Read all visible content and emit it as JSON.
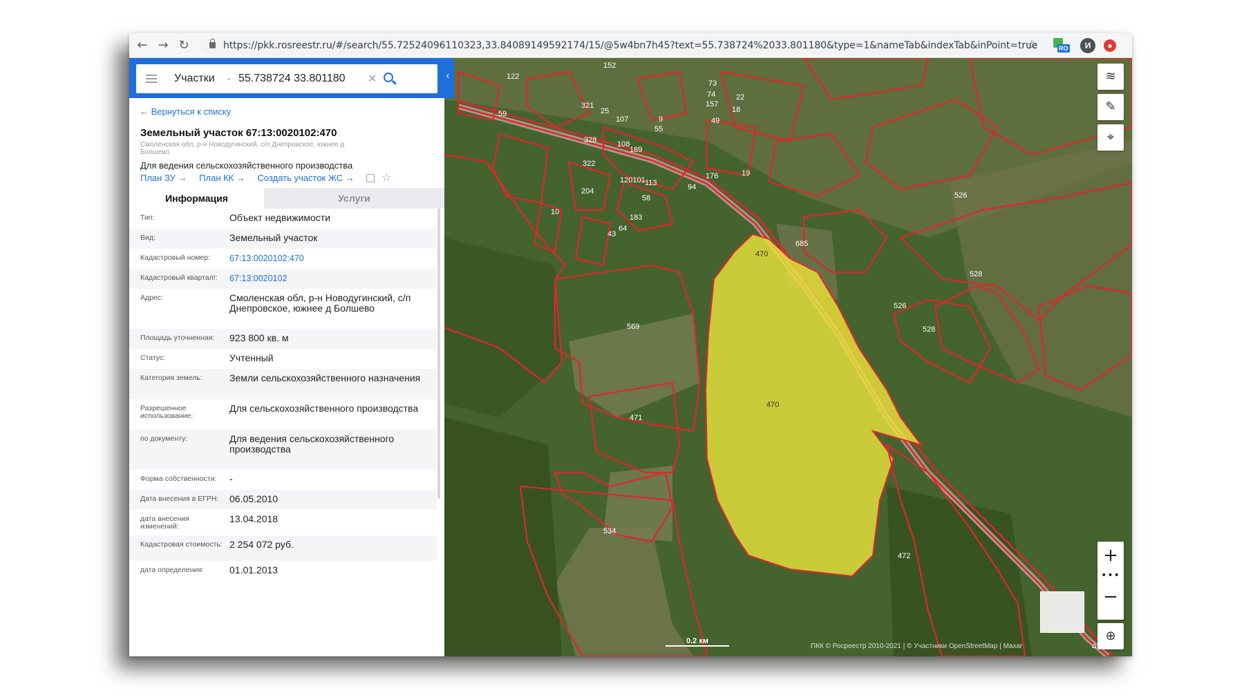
{
  "browser": {
    "url": "https://pkk.rosreestr.ru/#/search/55.72524096110323,33.84089149592174/15/@5w4bn7h45?text=55.738724%2033.801180&type=1&nameTab&indexTab&inPoint=true",
    "avatar_letter": "И",
    "ext_badge": "RO"
  },
  "search": {
    "type": "Участки",
    "query": "55.738724 33.801180"
  },
  "card": {
    "back_link": "← Вернуться к списку",
    "title": "Земельный участок 67:13:0020102:470",
    "address_small": "Смоленская обл, р-н Новодугинский, с/п Днепровское, южнее д Болшево",
    "purpose": "Для ведения сельскохозяйственного производства",
    "links": [
      "План ЗУ →",
      "План КК →",
      "Создать участок ЖС →"
    ]
  },
  "tabs": [
    "Информация",
    "Услуги"
  ],
  "info_rows": [
    {
      "label": "Тип:",
      "value": "Объект недвижимости",
      "h": 29
    },
    {
      "label": "Вид:",
      "value": "Земельный участок",
      "h": 29
    },
    {
      "label": "Кадастровый номер:",
      "value": "67:13:0020102:470",
      "h": 29,
      "link": true
    },
    {
      "label": "Кадастровый квартал!:",
      "value": "67:13:0020102",
      "h": 29,
      "link": true
    },
    {
      "label": "Адрес:",
      "value": "Смоленская обл, р-н Новодугинский, с/п Днепровское, южнее д Болшево",
      "h": 58
    },
    {
      "label": "Площадь уточненная:",
      "value": "923 800 кв. м",
      "h": 29
    },
    {
      "label": "Статус:",
      "value": "Учтенный",
      "h": 29
    },
    {
      "label": "Категория земель:",
      "value": "Земли сельскохозяйственного назначения",
      "h": 44
    },
    {
      "label": "Разрешенное использование:",
      "value": "Для сельскохозяйственного производства",
      "h": 44
    },
    {
      "label": "по документу:",
      "value": "Для ведения сельскохозяйственного производства",
      "h": 58
    },
    {
      "label": "Форма собственности:",
      "value": "-",
      "h": 29
    },
    {
      "label": "Дата внесения в ЕГРН:",
      "value": "06.05.2010",
      "h": 29
    },
    {
      "label": "дата внесения изменений:",
      "value": "13.04.2018",
      "h": 37
    },
    {
      "label": "Кадастровая стоимость:",
      "value": "2 254 072 руб.",
      "h": 37
    },
    {
      "label": "дата определения:",
      "value": "01.01.2013",
      "h": 29
    }
  ],
  "map": {
    "scale": "0.2 км",
    "copyright": "ПКК © Росреестр 2010-2021 | © Участники OpenStreetMap | Maxar",
    "parcel_labels": [
      "470",
      "470",
      "685",
      "569",
      "471",
      "534",
      "472",
      "526",
      "526",
      "528",
      "528",
      "120101",
      "94",
      "176",
      "19",
      "10",
      "204",
      "322",
      "328",
      "321",
      "25",
      "107",
      "108",
      "189",
      "113",
      "58",
      "43",
      "64",
      "183",
      "9",
      "55",
      "73",
      "74",
      "157",
      "49",
      "18",
      "22",
      "152",
      "59",
      "122"
    ],
    "colors": {
      "parcel_border": "#e0262d",
      "selected_fill": "#e8e23a"
    }
  }
}
